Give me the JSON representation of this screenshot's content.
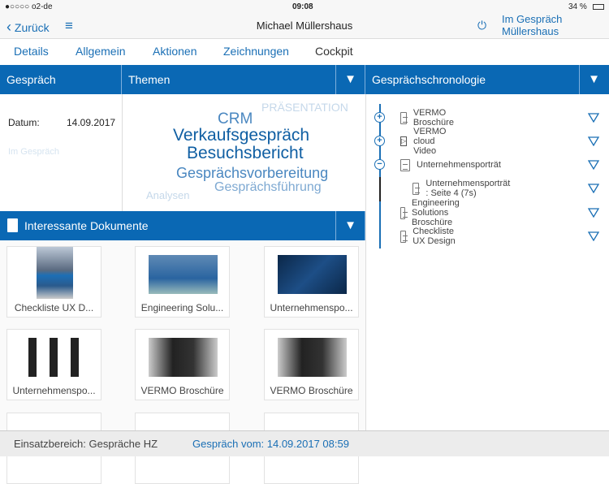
{
  "status": {
    "carrier": "●○○○○ o2-de",
    "time": "09:08",
    "battery": "34 %"
  },
  "nav": {
    "back": "Zurück",
    "title": "Michael Müllershaus",
    "status_line1": "Im Gespräch",
    "status_line2": "Müllershaus"
  },
  "tabs": [
    "Details",
    "Allgemein",
    "Aktionen",
    "Zeichnungen",
    "Cockpit"
  ],
  "gespraech": {
    "header": "Gespräch",
    "datum_label": "Datum:",
    "datum_value": "14.09.2017",
    "placeholder": "Im Gespräch"
  },
  "themen": {
    "header": "Themen",
    "tags": [
      "PRÄSENTATION",
      "CRM",
      "Verkaufsgespräch",
      "Besuchsbericht",
      "Gesprächsvorbereitung",
      "Gesprächsführung",
      "Analysen"
    ]
  },
  "chronologie": {
    "header": "Gesprächschronologie",
    "items": [
      {
        "label": "VERMO Broschüre",
        "icon": "document-icon",
        "toggle": "plus"
      },
      {
        "label": "VERMO cloud Video",
        "icon": "video-icon",
        "toggle": "plus"
      },
      {
        "label": "Unternehmensporträt",
        "icon": "document-icon",
        "toggle": "minus"
      },
      {
        "label": "Unternehmensporträt : Seite 4 (7s)",
        "icon": "document-icon",
        "toggle": "none"
      },
      {
        "label": "Engineering Solutions Broschüre",
        "icon": "document-icon",
        "toggle": "none"
      },
      {
        "label": "Checkliste UX Design",
        "icon": "document-icon",
        "toggle": "none"
      }
    ]
  },
  "dokumente": {
    "header": "Interessante Dokumente",
    "cards": [
      "Checkliste UX D...",
      "Engineering Solu...",
      "Unternehmenspo...",
      "Unternehmenspo...",
      "VERMO Broschüre",
      "VERMO Broschüre",
      "",
      "",
      ""
    ]
  },
  "footer": {
    "einsatz": "Einsatzbereich: Gespräche HZ",
    "gespraech_vom": "Gespräch vom: 14.09.2017 08:59"
  },
  "colors": {
    "accent": "#0a68b4"
  }
}
